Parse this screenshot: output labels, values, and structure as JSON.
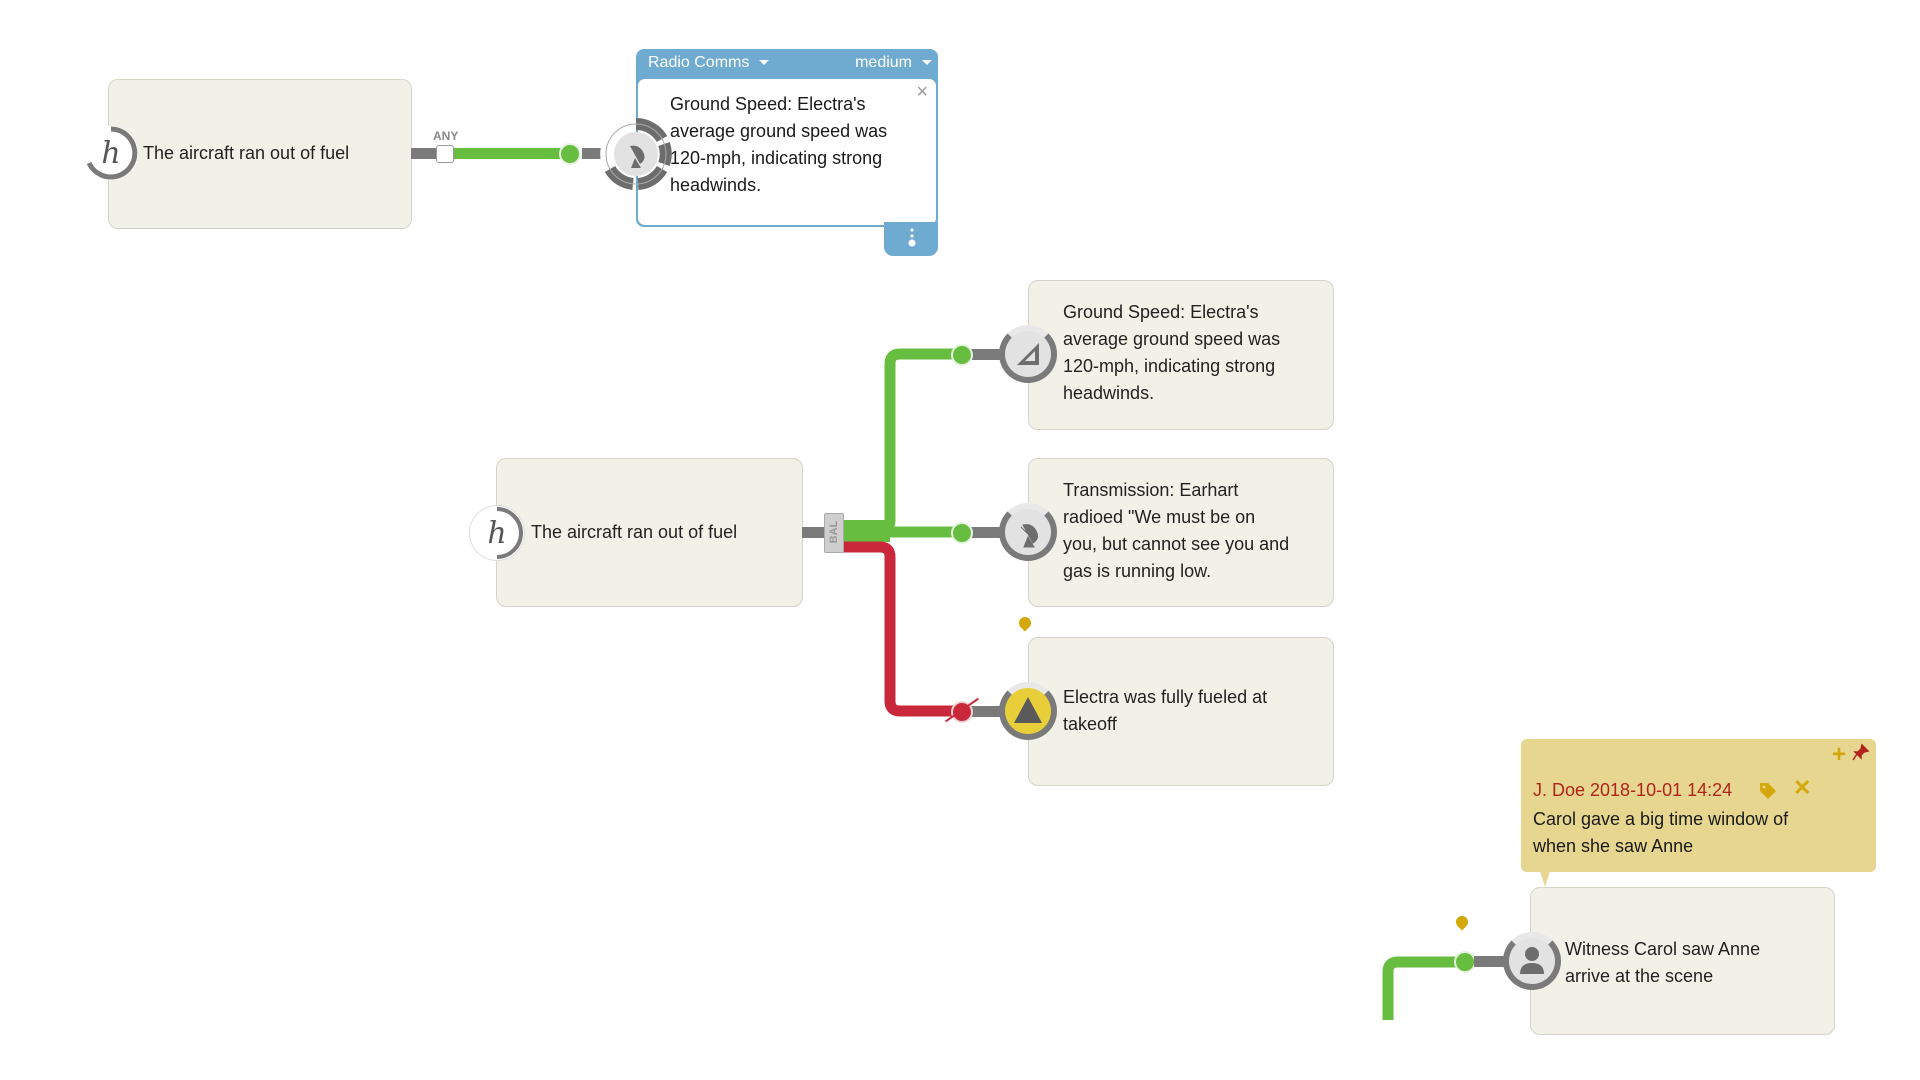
{
  "colors": {
    "support": "#67bd3f",
    "refute": "#c9283a",
    "connector": "#7a7a7a",
    "card_bg": "#f2f1e8",
    "popup_accent": "#6fabd1",
    "note_bg": "#e6d68f",
    "note_author": "#b0241c",
    "pin": "#d4a80a"
  },
  "top_diagram": {
    "hypothesis": {
      "icon": "hypothesis-h-icon",
      "label": "The aircraft ran out of fuel"
    },
    "connector_label": "ANY",
    "evidence_popup": {
      "category": "Radio Comms",
      "strength": "medium",
      "text": "Ground Speed: Electra's average ground speed was 120-mph, indicating strong headwinds.",
      "icon": "radio-dish-icon",
      "close_icon": "close-icon",
      "footer_icon": "more-vertical-icon"
    }
  },
  "middle_diagram": {
    "hypothesis": {
      "icon": "hypothesis-h-icon",
      "label": "The aircraft ran out of fuel"
    },
    "junction_label": "BAL",
    "evidence": [
      {
        "icon": "ruler-triangle-icon",
        "text": "Ground Speed: Electra's average ground speed was 120-mph, indicating strong headwinds.",
        "relation": "supports"
      },
      {
        "icon": "radio-dish-icon",
        "text": "Transmission: Earhart radioed \"We must be on you, but cannot see you and gas is running low.",
        "relation": "supports"
      },
      {
        "icon": "warning-triangle-icon",
        "text": "Electra was fully fueled at takeoff",
        "relation": "refutes",
        "has_note_pin": true
      }
    ]
  },
  "note": {
    "author_line": "J. Doe 2018-10-01 14:24",
    "text": "Carol gave a big time window of when she saw Anne",
    "icons": [
      "add-icon",
      "pin-icon",
      "tag-icon",
      "delete-icon"
    ]
  },
  "witness_card": {
    "icon": "person-icon",
    "text": "Witness Carol saw Anne arrive at the scene",
    "relation": "supports",
    "has_note_pin": true
  }
}
